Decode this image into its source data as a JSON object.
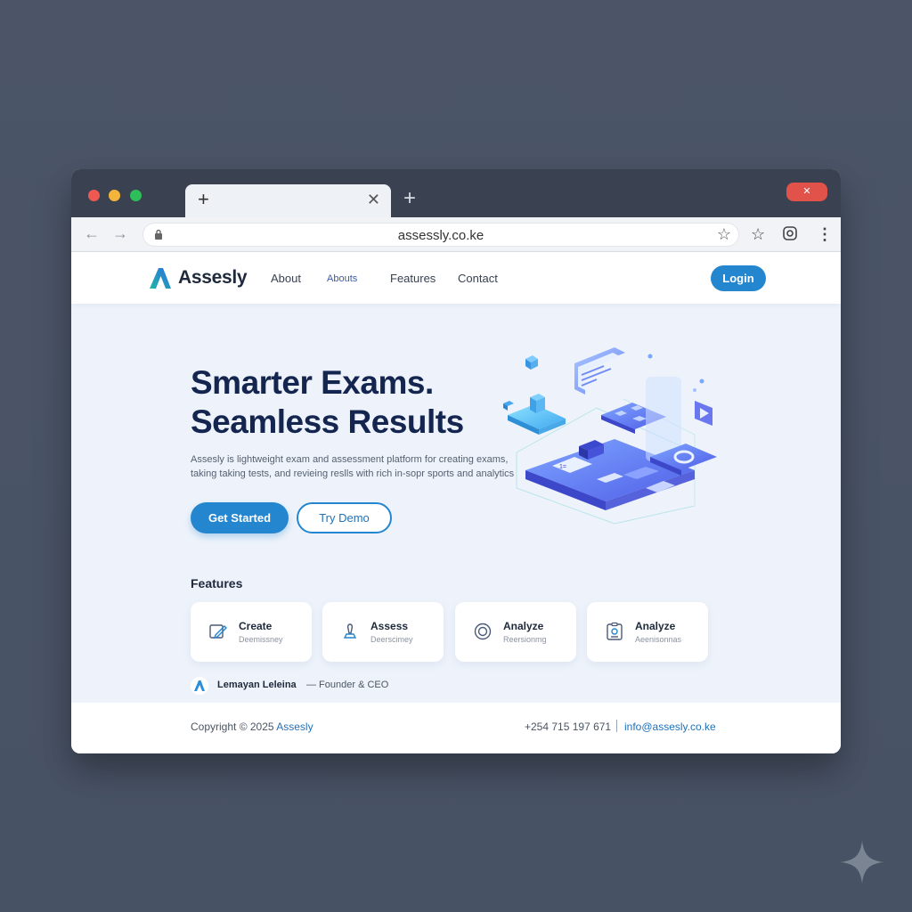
{
  "browser": {
    "tab_title": "",
    "url": "assessly.co.ke",
    "window_button": "✕"
  },
  "site": {
    "brand": "Assesly",
    "nav": [
      "About",
      "Abouts",
      "Features",
      "Contact"
    ],
    "login_label": "Login"
  },
  "hero": {
    "title_line1": "Smarter Exams.",
    "title_line2": "Seamless Results",
    "description": "Assesly is lightweight exam and assessment platform for creating exams, taking taking tests, and revieing reslls with rich in-sopr sports and analytics",
    "primary_cta": "Get Started",
    "secondary_cta": "Try Demo"
  },
  "features": {
    "heading": "Features",
    "cards": [
      {
        "title": "Create",
        "subtitle": "Deemissney",
        "icon": "edit-icon"
      },
      {
        "title": "Assess",
        "subtitle": "Deerscimey",
        "icon": "pin-icon"
      },
      {
        "title": "Analyze",
        "subtitle": "Reersionmg",
        "icon": "target-icon"
      },
      {
        "title": "Analyze",
        "subtitle": "Aeenisonnas",
        "icon": "report-icon"
      }
    ]
  },
  "founder": {
    "name": "Lemayan Leleina",
    "role": "— Founder & CEO"
  },
  "footer": {
    "copyright_prefix": "Copyright © 2025",
    "copyright_brand": "Assesly",
    "phone": "+254 715 197 671",
    "email": "info@assesly.co.ke"
  },
  "colors": {
    "accent": "#2386cf",
    "heading": "#14264f",
    "titlebar": "#3a4150",
    "close_button": "#e0524a"
  }
}
